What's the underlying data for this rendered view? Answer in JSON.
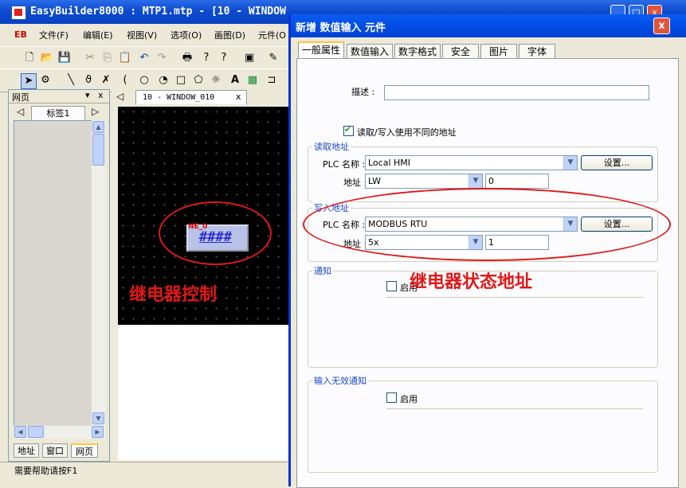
{
  "main_window": {
    "title": "EasyBuilder8000 : MTP1.mtp - [10 - WINDOW",
    "menu": [
      "文件(F)",
      "编辑(E)",
      "视图(V)",
      "选项(O)",
      "画图(D)",
      "元件(O"
    ],
    "logo": "EB",
    "controls": {
      "minimize": "_",
      "maximize": "□",
      "close": "x"
    }
  },
  "left_panel": {
    "title": "网页",
    "tab": "标签1",
    "bottom_tabs": [
      "地址",
      "窗口",
      "网页"
    ],
    "pin": "▾",
    "close": "x"
  },
  "canvas": {
    "tab_title": "10 - WINDOW_010",
    "tab_close": "x",
    "element_text": "####",
    "element_label": "NE_0"
  },
  "status_bar": {
    "text": "需要帮助请按F1"
  },
  "dialog": {
    "title": "新增 数值输入 元件",
    "close": "x",
    "tabs": [
      "一般属性",
      "数值输入",
      "数字格式",
      "安全",
      "图片",
      "字体"
    ],
    "description_label": "描述 :",
    "description_value": "",
    "rw_diff_label": "读取/写入使用不同的地址",
    "rw_diff_checked": true,
    "read_address": {
      "group_label": "读取地址",
      "plc_name_label": "PLC 名称 :",
      "plc_name_value": "Local HMI",
      "settings_button": "设置...",
      "address_label": "地址 :",
      "address_type": "LW",
      "address_value": "0"
    },
    "write_address": {
      "group_label": "写入地址",
      "plc_name_label": "PLC 名称 :",
      "plc_name_value": "MODBUS RTU",
      "settings_button": "设置...",
      "address_label": "地址 :",
      "address_type": "5x",
      "address_value": "1"
    },
    "notify": {
      "group_label": "通知",
      "enable_label": "启用",
      "enabled": false
    },
    "invalid_notify": {
      "group_label": "输入无效通知",
      "enable_label": "启用",
      "enabled": false
    }
  },
  "annotations": {
    "relay_control": "继电器控制",
    "relay_status_address": "继电器状态地址"
  },
  "colors": {
    "annotation_red": "#e01818",
    "xp_blue": "#0a5bf0"
  }
}
